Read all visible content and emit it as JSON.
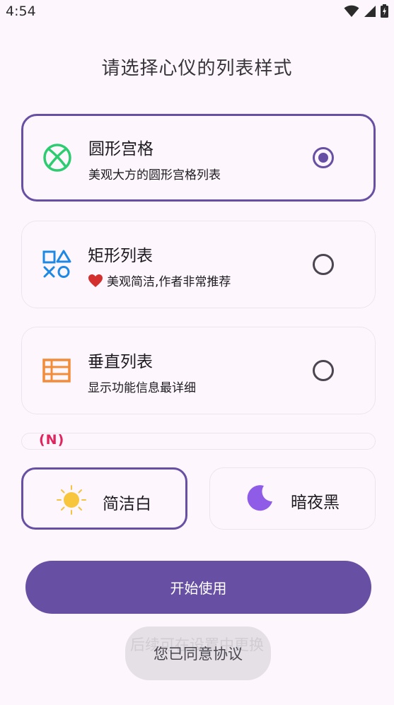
{
  "status_bar": {
    "time": "4:54"
  },
  "title": "请选择心仪的列表样式",
  "layouts": [
    {
      "name": "圆形宫格",
      "desc": "美观大方的圆形宫格列表",
      "icon": "xbox-icon",
      "selected": true
    },
    {
      "name": "矩形列表",
      "desc": "美观简洁,作者非常推荐",
      "desc_icon": "heart-icon",
      "icon": "playstation-symbols-icon",
      "selected": false
    },
    {
      "name": "垂直列表",
      "desc": "显示功能信息最详细",
      "icon": "table-list-icon",
      "selected": false
    }
  ],
  "partial_badge": "(N)",
  "themes": [
    {
      "label": "简洁白",
      "icon": "sun-icon",
      "selected": true
    },
    {
      "label": "暗夜黑",
      "icon": "moon-icon",
      "selected": false
    }
  ],
  "start_button": "开始使用",
  "hint": "后续可在设置中更换",
  "toast": "您已同意协议",
  "colors": {
    "primary": "#6750A4",
    "xbox_green": "#2ECC71",
    "ps_blue": "#1E88E5",
    "list_orange": "#F28C38",
    "badge_red": "#E0245E"
  }
}
